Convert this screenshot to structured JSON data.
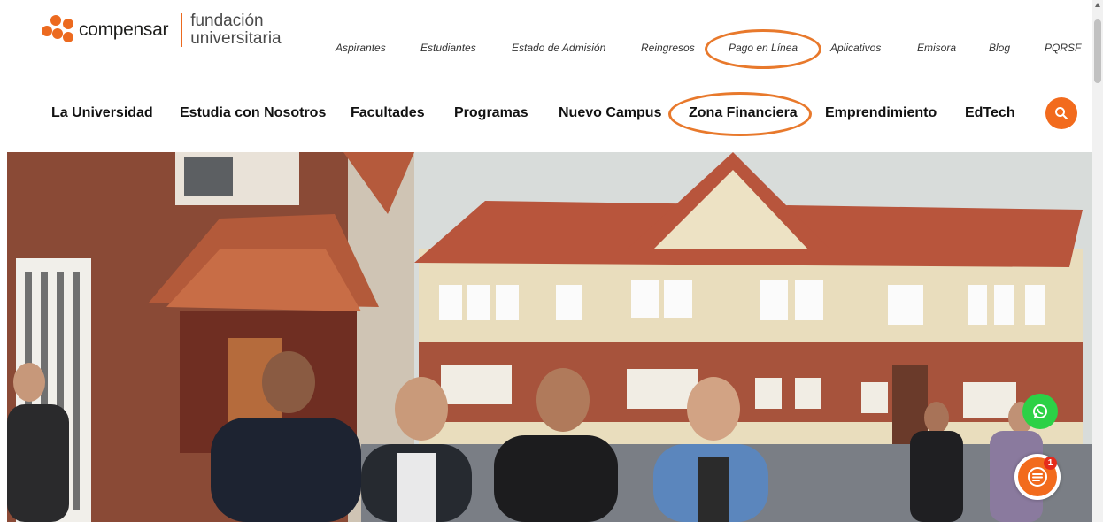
{
  "logo": {
    "brand": "compensar",
    "line1": "fundación",
    "line2": "universitaria"
  },
  "top_nav": [
    "Aspirantes",
    "Estudiantes",
    "Estado de Admisión",
    "Reingresos",
    "Pago en Línea",
    "Aplicativos",
    "Emisora",
    "Blog",
    "PQRSF"
  ],
  "main_nav": [
    "La Universidad",
    "Estudia con Nosotros",
    "Facultades",
    "Programas",
    "Nuevo Campus",
    "Zona Financiera",
    "Emprendimiento",
    "EdTech"
  ],
  "icons": {
    "search": "search-icon",
    "whatsapp": "whatsapp-icon",
    "chat": "chat-icon"
  },
  "chat_badge": "1",
  "colors": {
    "brand_orange": "#f26b1d",
    "highlight_circle": "#e8792c",
    "whatsapp_green": "#2cd146",
    "badge_red": "#e52b1c"
  }
}
